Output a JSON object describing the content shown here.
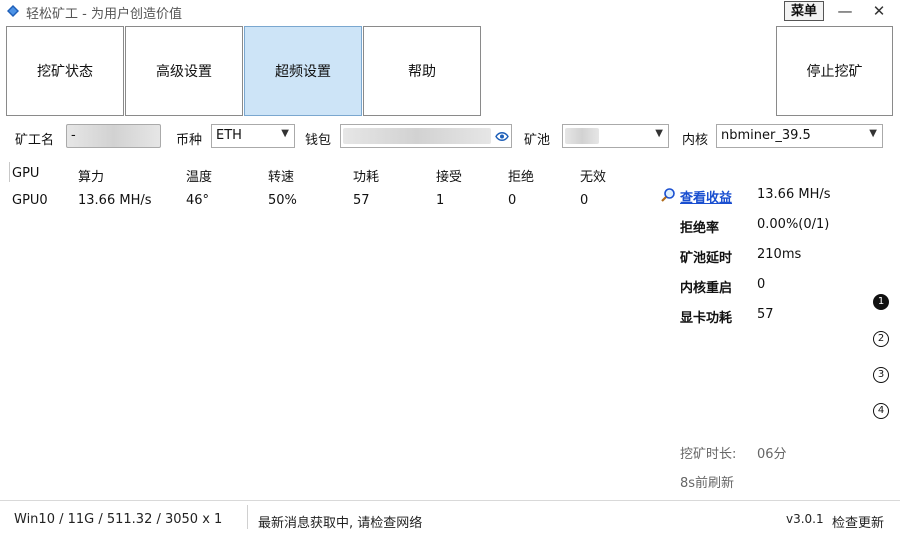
{
  "window": {
    "title": "轻松矿工 - 为用户创造价值",
    "menu_label": "菜单",
    "minimize_label": "—",
    "close_label": "✕"
  },
  "tabs": [
    {
      "label": "挖矿状态",
      "active": false
    },
    {
      "label": "高级设置",
      "active": false
    },
    {
      "label": "超频设置",
      "active": true
    },
    {
      "label": "帮助",
      "active": false
    }
  ],
  "stop_button_label": "停止挖矿",
  "form": {
    "miner_name_label": "矿工名",
    "miner_name_value": "-",
    "coin_label": "币种",
    "coin_value": "ETH",
    "wallet_label": "钱包",
    "pool_label": "矿池",
    "kernel_label": "内核",
    "kernel_value": "nbminer_39.5"
  },
  "table": {
    "headers": [
      "GPU",
      "算力",
      "温度",
      "转速",
      "功耗",
      "接受",
      "拒绝",
      "无效"
    ],
    "rows": [
      [
        "GPU0",
        "13.66 MH/s",
        "46°",
        "50%",
        "57",
        "1",
        "0",
        "0"
      ]
    ]
  },
  "stats": {
    "view_earnings_label": "查看收益",
    "hashrate": "13.66 MH/s",
    "reject_rate_label": "拒绝率",
    "reject_rate": "0.00%(0/1)",
    "pool_latency_label": "矿池延时",
    "pool_latency": "210ms",
    "kernel_restart_label": "内核重启",
    "kernel_restart": "0",
    "gpu_power_label": "显卡功耗",
    "gpu_power": "57"
  },
  "pages": [
    "1",
    "2",
    "3",
    "4"
  ],
  "mining_time_label": "挖矿时长:",
  "mining_time_value": "06分",
  "refresh_text": "8s前刷新",
  "statusbar": {
    "system_info": "Win10  / 11G / 511.32 / 3050 x 1",
    "message": "最新消息获取中, 请检查网络",
    "version_text": "v3.0.1",
    "update_label": "检查更新"
  },
  "colors": {
    "active_tab": "#cde4f7",
    "link": "#1a4fd0"
  },
  "icons": [
    "app-logo-icon",
    "eye-icon",
    "search-icon",
    "chevron-down-icon"
  ]
}
